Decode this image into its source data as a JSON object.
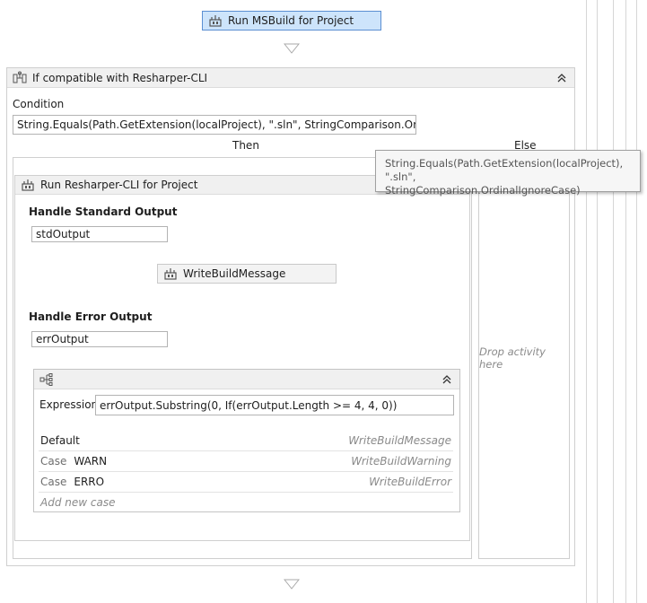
{
  "top_activity": {
    "label": "Run MSBuild for Project"
  },
  "if_activity": {
    "title": "If compatible with Resharper-CLI",
    "condition_label": "Condition",
    "condition_value": "String.Equals(Path.GetExtension(localProject), \".sln\", StringComparison.OrdinalIgno",
    "then_label": "Then",
    "else_label": "Else",
    "else_placeholder": "Drop activity here"
  },
  "tooltip": {
    "line1": "String.Equals(Path.GetExtension(localProject), \".sln\",",
    "line2": "StringComparison.OrdinalIgnoreCase)"
  },
  "resharper_activity": {
    "title": "Run Resharper-CLI for Project",
    "std_output_label": "Handle Standard Output",
    "std_output_value": "stdOutput",
    "write_build_message": "WriteBuildMessage",
    "err_output_label": "Handle Error Output",
    "err_output_value": "errOutput"
  },
  "switch_activity": {
    "expression_label": "Expression",
    "expression_value": "errOutput.Substring(0, If(errOutput.Length >= 4, 4, 0))",
    "default_label": "Default",
    "default_activity": "WriteBuildMessage",
    "cases": [
      {
        "case_word": "Case",
        "key": "WARN",
        "activity": "WriteBuildWarning"
      },
      {
        "case_word": "Case",
        "key": "ERRO",
        "activity": "WriteBuildError"
      }
    ],
    "add_case_label": "Add new case"
  },
  "colors": {
    "selected_bg": "#cde4fb",
    "selected_border": "#5b8fd2",
    "header_bg": "#f0f0f0",
    "placeholder_text": "#8a8a8a"
  }
}
